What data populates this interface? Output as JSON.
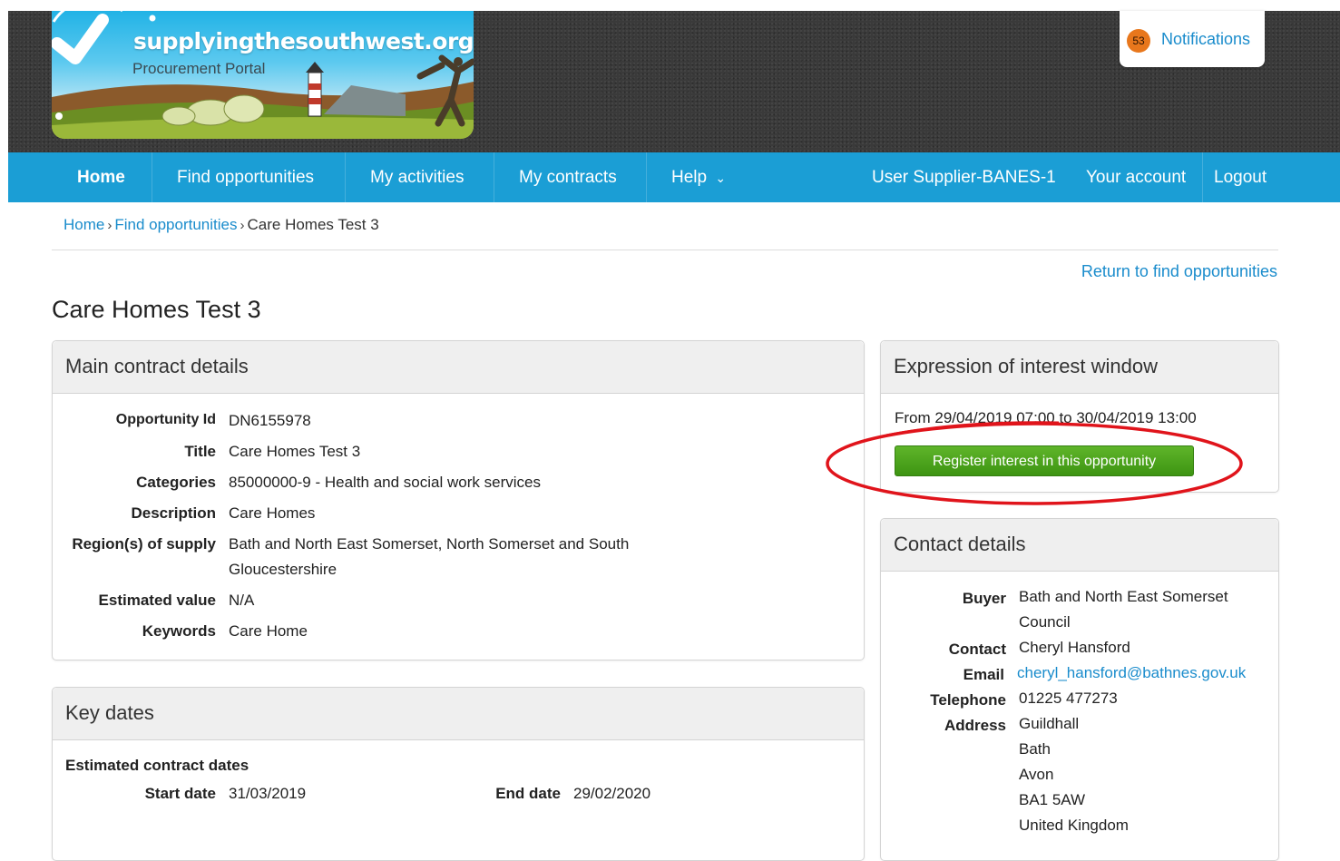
{
  "header": {
    "logo_title": "supplyingthesouthwest.org.uk",
    "logo_subtitle": "Procurement Portal",
    "notifications_count": "53",
    "notifications_label": "Notifications"
  },
  "nav": {
    "home": "Home",
    "find": "Find opportunities",
    "activities": "My activities",
    "contracts": "My contracts",
    "help": "Help",
    "help_caret": "⌄",
    "user": "User Supplier-BANES-1",
    "account": "Your account",
    "logout": "Logout"
  },
  "breadcrumb": {
    "home": "Home",
    "sep": "›",
    "find": "Find opportunities",
    "current": "Care Homes Test 3"
  },
  "return_link": "Return to find opportunities",
  "page_title": "Care Homes Test 3",
  "main_details": {
    "heading": "Main contract details",
    "rows": [
      {
        "label": "Opportunity Id",
        "value": "DN6155978"
      },
      {
        "label": "Title",
        "value": "Care Homes Test 3"
      },
      {
        "label": "Categories",
        "value": "85000000-9 - Health and social work services"
      },
      {
        "label": "Description",
        "value": "Care Homes"
      },
      {
        "label": "Region(s) of supply",
        "value": "Bath and North East Somerset, North Somerset and South Gloucestershire"
      },
      {
        "label": "Estimated value",
        "value": "N/A"
      },
      {
        "label": "Keywords",
        "value": "Care Home"
      }
    ]
  },
  "key_dates": {
    "heading": "Key dates",
    "subheading": "Estimated contract dates",
    "start_label": "Start date",
    "start_value": "31/03/2019",
    "end_label": "End date",
    "end_value": "29/02/2020"
  },
  "eoi": {
    "heading": "Expression of interest window",
    "window_text": "From 29/04/2019 07:00 to 30/04/2019 13:00",
    "button_label": "Register interest in this opportunity"
  },
  "contact": {
    "heading": "Contact details",
    "buyer_label": "Buyer",
    "buyer_value": "Bath and North East Somerset Council",
    "contact_label": "Contact",
    "contact_value": "Cheryl Hansford",
    "email_label": "Email",
    "email_value": "cheryl_hansford@bathnes.gov.uk",
    "telephone_label": "Telephone",
    "telephone_value": "01225 477273",
    "address_label": "Address",
    "address_lines": [
      "Guildhall",
      "Bath",
      "Avon",
      "BA1 5AW",
      "United Kingdom"
    ]
  },
  "colors": {
    "nav_blue": "#1b9ed5",
    "link_blue": "#1a8ccc",
    "button_green": "#4ea51e",
    "highlight_red": "#e0141b",
    "notification_orange": "#e8771c"
  }
}
